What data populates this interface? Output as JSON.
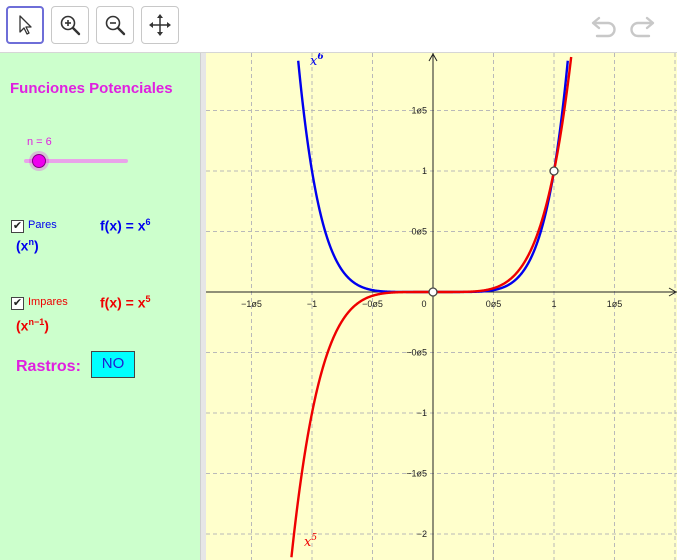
{
  "toolbar": {
    "tools": [
      "move-tool",
      "zoom-in-tool",
      "zoom-out-tool",
      "pan-tool"
    ],
    "active_tool": "move-tool"
  },
  "panel": {
    "title": "Funciones Potenciales",
    "slider": {
      "label": "n = 6",
      "value": 6
    },
    "pares": {
      "checkbox_label": "Pares",
      "checked": true,
      "notation_base": "(x",
      "notation_exp": "n",
      "notation_close": ")",
      "formula": "f(x) = x",
      "formula_exp": "6"
    },
    "impares": {
      "checkbox_label": "Impares",
      "checked": true,
      "notation_base": "(x",
      "notation_exp": "n−1",
      "notation_close": ")",
      "formula": "f(x) = x",
      "formula_exp": "5"
    },
    "rastros_label": "Rastros:",
    "rastros_button": "NO"
  },
  "graph": {
    "x_ticks": [
      "−1ø5",
      "−1",
      "−0ø5",
      "0",
      "0ø5",
      "1",
      "1ø5"
    ],
    "y_ticks": [
      "1ø5",
      "1",
      "0ø5",
      "−0ø5",
      "−1",
      "−1ø5",
      "−2"
    ],
    "curve_label_even_base": "x",
    "curve_label_even_exp": "6",
    "curve_label_odd_base": "x",
    "curve_label_odd_exp": "5"
  },
  "colors": {
    "even_curve": "#0000ee",
    "odd_curve": "#ee0000",
    "panel_bg": "#ccffcc",
    "graph_bg": "#ffffcc",
    "title": "#e020e0"
  },
  "chart_data": {
    "type": "line",
    "series": [
      {
        "name": "x^6",
        "function": "x^6",
        "color": "#0000ee"
      },
      {
        "name": "x^5",
        "function": "x^5",
        "color": "#ee0000"
      }
    ],
    "points": [
      {
        "x": 0,
        "y": 0
      },
      {
        "x": 1,
        "y": 1
      }
    ],
    "xlim": [
      -1.85,
      2.0
    ],
    "ylim": [
      -2.2,
      1.95
    ],
    "grid": true
  }
}
